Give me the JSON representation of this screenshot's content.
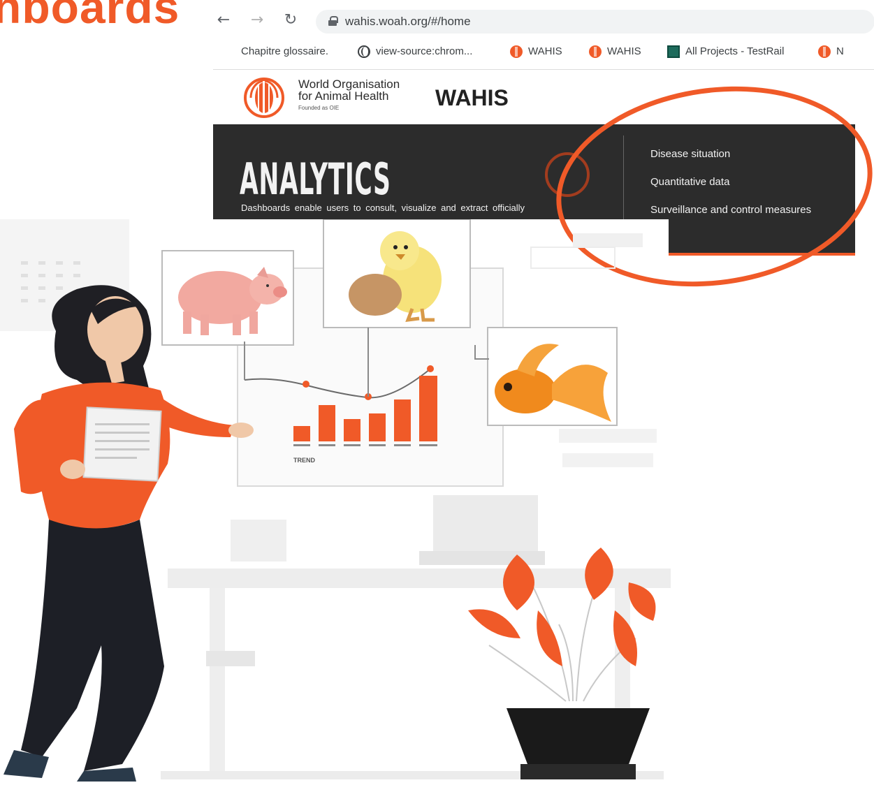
{
  "heading": {
    "text": "hboards"
  },
  "browser": {
    "url": "wahis.woah.org/#/home",
    "bookmarks": [
      {
        "label": "Chapitre glossaire.",
        "icon": "none"
      },
      {
        "label": "view-source:chrom...",
        "icon": "globe-icon"
      },
      {
        "label": "WAHIS",
        "icon": "woah-favicon-icon"
      },
      {
        "label": "WAHIS",
        "icon": "woah-favicon-icon"
      },
      {
        "label": "All Projects - TestRail",
        "icon": "testrail-icon"
      },
      {
        "label": "N",
        "icon": "woah-favicon-icon"
      }
    ]
  },
  "site": {
    "org_line1": "World Organisation",
    "org_line2": "for Animal Health",
    "org_line3": "Founded as OIE",
    "brand": "WAHIS"
  },
  "analytics": {
    "title": "ANALYTICS",
    "description": "Dashboards enable users to consult, visualize and extract officially",
    "menu": [
      "Disease situation",
      "Quantitative data",
      "Surveillance and control measures"
    ]
  },
  "illustration": {
    "chart_label": "TREND",
    "accent_color": "#f05a28"
  },
  "colors": {
    "accent": "#f05a28",
    "band": "#2c2c2c"
  }
}
